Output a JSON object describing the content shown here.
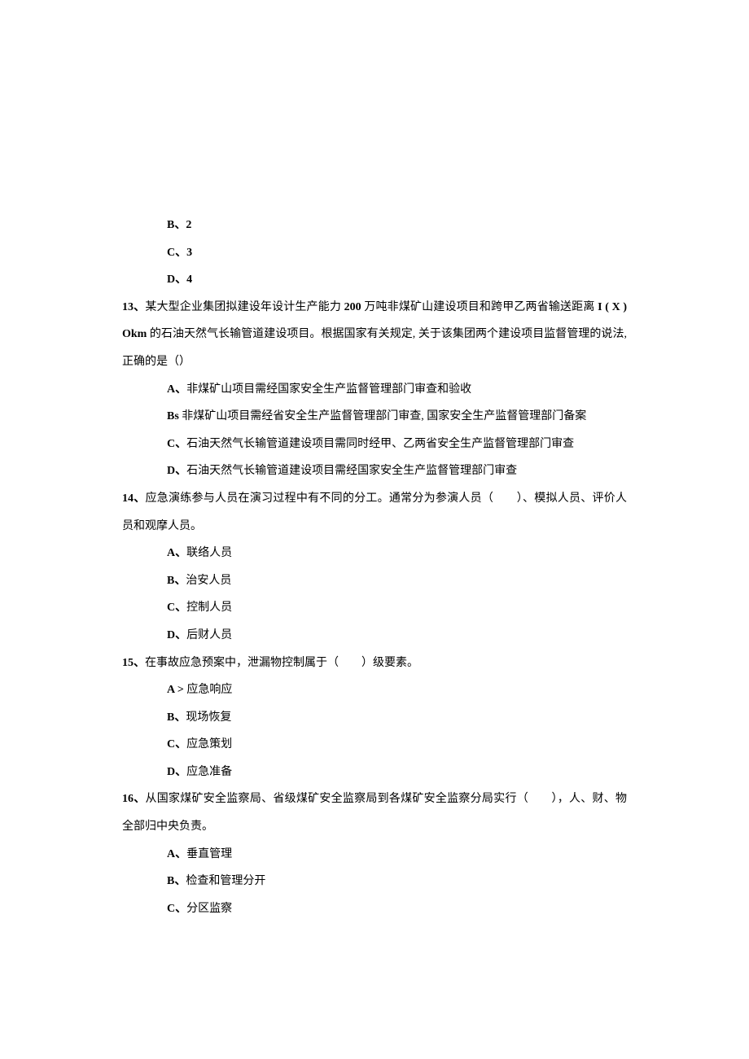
{
  "leadingOptions": {
    "b": {
      "label": "B、",
      "text": "2"
    },
    "c": {
      "label": "C、",
      "text": "3"
    },
    "d": {
      "label": "D、",
      "text": "4"
    }
  },
  "q13": {
    "num": "13、",
    "seg1": "某大型企业集团拟建设年设计生产能力 ",
    "bold1": "200 ",
    "seg2": "万吨非煤矿山建设项目和跨甲乙两省输送距离 ",
    "bold2": "I ( X ) Okm ",
    "seg3": "的石油天然气长输管道建设项目。根据国家有关规定, 关于该集团两个建设项目监督管理的说法, 正确的是（）",
    "optA": {
      "label": "A、",
      "text": "非煤矿山项目需经国家安全生产监督管理部门审查和验收"
    },
    "optB": {
      "label": "Bs ",
      "text": "非煤矿山项目需经省安全生产监督管理部门审查, 国家安全生产监督管理部门备案"
    },
    "optC": {
      "label": "C、",
      "text": "石油天然气长输管道建设项目需同时经甲、乙两省安全生产监督管理部门审查"
    },
    "optD": {
      "label": "D、",
      "text": "石油天然气长输管道建设项目需经国家安全生产监督管理部门审查"
    }
  },
  "q14": {
    "num": "14、",
    "seg1": "应急演练参与人员在演习过程中有不同的分工。通常分为参演人员（　　）、模拟人员、评价人员和观摩人员。",
    "optA": {
      "label": "A、",
      "text": "联络人员"
    },
    "optB": {
      "label": "B、",
      "text": "治安人员"
    },
    "optC": {
      "label": "C、",
      "text": "控制人员"
    },
    "optD": {
      "label": "D、",
      "text": "后财人员"
    }
  },
  "q15": {
    "num": "15、",
    "seg1": "在事故应急预案中，泄漏物控制属于（　　）级要素。",
    "optA": {
      "label": "A > ",
      "text": "应急响应"
    },
    "optB": {
      "label": "B、",
      "text": "现场恢复"
    },
    "optC": {
      "label": "C、",
      "text": "应急策划"
    },
    "optD": {
      "label": "D、",
      "text": "应急准备"
    }
  },
  "q16": {
    "num": "16、",
    "seg1": "从国家煤矿安全监察局、省级煤矿安全监察局到各煤矿安全监察分局实行（　　），人、财、物全部归中央负责。",
    "optA": {
      "label": "A、",
      "text": "垂直管理"
    },
    "optB": {
      "label": "B、",
      "text": "检查和管理分开"
    },
    "optC": {
      "label": "C、",
      "text": "分区监察"
    }
  }
}
